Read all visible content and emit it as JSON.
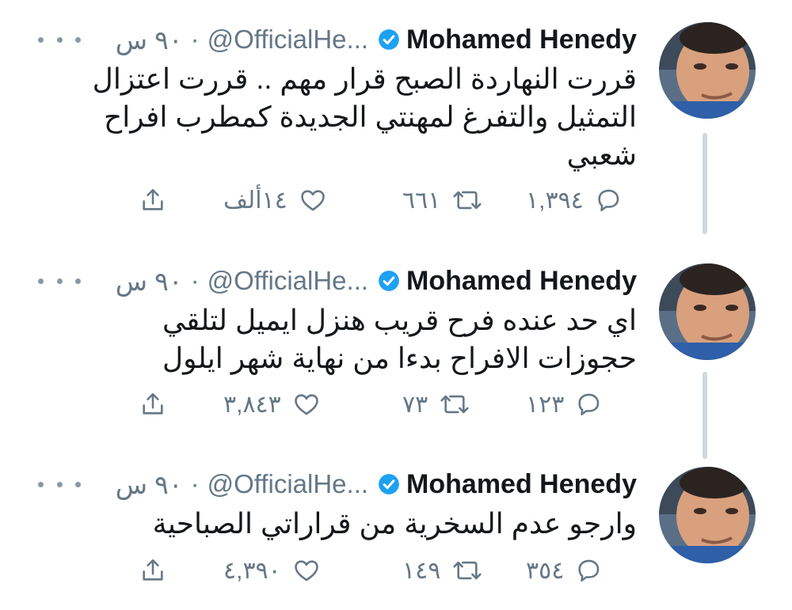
{
  "tweets": [
    {
      "name": "Mohamed Henedy",
      "handle": "@OfficialHe...",
      "separator": "·",
      "time": "٩٠ س",
      "text": "قررت النهاردة الصبح قرار مهم .. قررت اعتزال التمثيل والتفرغ لمهنتي الجديدة كمطرب افراح شعبي",
      "replies": "١,٣٩٤",
      "retweets": "٦٦١",
      "likes": "١٤ألف"
    },
    {
      "name": "Mohamed Henedy",
      "handle": "@OfficialHe...",
      "separator": "·",
      "time": "٩٠ س",
      "text": "اي حد عنده فرح قريب هنزل ايميل لتلقي حجوزات الافراح  بدءا من نهاية شهر ايلول",
      "replies": "١٢٣",
      "retweets": "٧٣",
      "likes": "٣,٨٤٣"
    },
    {
      "name": "Mohamed Henedy",
      "handle": "@OfficialHe...",
      "separator": "·",
      "time": "٩٠ س",
      "text": "وارجو عدم السخرية من قراراتي الصباحية",
      "replies": "٣٥٤",
      "retweets": "١٤٩",
      "likes": "٤,٣٩٠"
    }
  ],
  "colors": {
    "text": "#14171a",
    "secondary": "#657786",
    "verified": "#1da1f2",
    "thread_line": "#cfd9de"
  },
  "icons": [
    "reply-icon",
    "retweet-icon",
    "like-icon",
    "share-icon",
    "verified-badge-icon",
    "more-icon"
  ]
}
